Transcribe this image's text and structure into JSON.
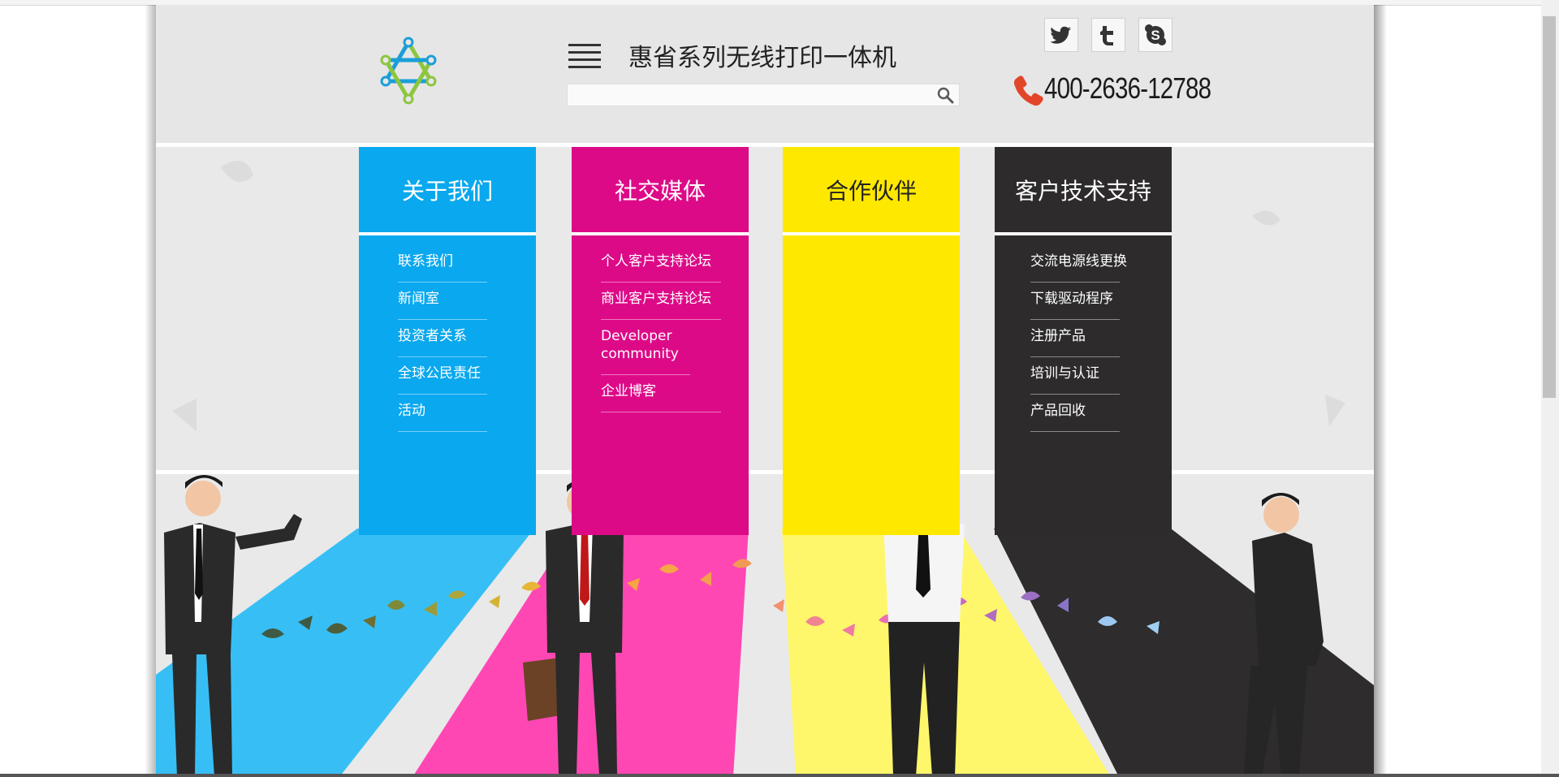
{
  "site": {
    "title": "惠省系列无线打印一体机",
    "phone": "400-2636-12788",
    "search_placeholder": ""
  },
  "icons": {
    "logo": "star-of-david-logo",
    "menu": "hamburger-menu-icon",
    "search": "magnifier-icon",
    "twitter": "twitter-icon",
    "tumblr": "tumblr-icon",
    "skype": "skype-icon",
    "phone": "phone-handset-icon"
  },
  "colors": {
    "cyan": "#0aa8ee",
    "magenta": "#dd0a88",
    "yellow": "#ffe800",
    "black": "#2d2b2c",
    "phone_icon": "#e2452a"
  },
  "columns": [
    {
      "title": "关于我们",
      "links": [
        "联系我们",
        "新闻室",
        "投资者关系",
        "全球公民责任",
        "活动"
      ]
    },
    {
      "title": "社交媒体",
      "links": [
        "个人客户支持论坛",
        "商业客户支持论坛",
        "Developer community",
        "企业博客"
      ]
    },
    {
      "title": "合作伙伴",
      "links": []
    },
    {
      "title": "客户技术支持",
      "links": [
        "交流电源线更换",
        "下载驱动程序",
        "注册产品",
        "培训与认证",
        "产品回收"
      ]
    }
  ]
}
